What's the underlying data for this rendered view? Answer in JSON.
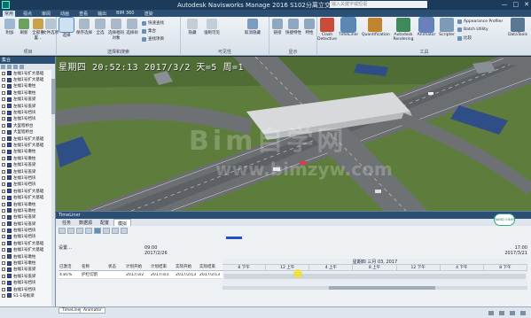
{
  "window": {
    "title": "Autodesk Navisworks Manage 2016    S102分离立交（老）.nwf",
    "search_placeholder": "输入关键字或短语",
    "min": "—",
    "max": "□",
    "close": "✕"
  },
  "menu": {
    "tabs": [
      "常用",
      "视点",
      "审阅",
      "动画",
      "查看",
      "输出",
      "BIM 360",
      "渲染"
    ],
    "active_index": 0
  },
  "ribbon": {
    "left_buttons": [
      "附加",
      "刷新",
      "全部重置…",
      "文件选项",
      "选择",
      "保存选择",
      "全选",
      "选择相同对象",
      "选择树"
    ],
    "group_labels": {
      "project": "项目",
      "select": "选择和搜索",
      "visibility": "可见性",
      "display": "显示",
      "tools": "工具"
    },
    "select_small": [
      "快速查找",
      "集合",
      "查找项目"
    ],
    "mid_buttons": [
      "隐藏",
      "强制可见",
      "取消隐藏",
      "链接",
      "快捷特性",
      "特性"
    ],
    "tool_buttons": [
      "Clash Detective",
      "TimeLiner",
      "Quantification",
      "Autodesk Rendering",
      "Animator",
      "Scripter",
      "DataTools"
    ],
    "tool_small": [
      "Appearance Profiler",
      "Batch Utility",
      "比较"
    ]
  },
  "left_panel": {
    "title": "集合",
    "items": [
      "左幅1号扩大基础",
      "左幅1号扩大基础",
      "左幅1号墩柱",
      "左幅1号墩柱",
      "左幅1号盖梁",
      "左幅1号盖梁",
      "左幅1号挡块",
      "左幅1号挡块",
      "大里程桥台",
      "大里程桥台",
      "左幅1号扩大基础",
      "左幅1号扩大基础",
      "左幅1号墩柱",
      "左幅1号墩柱",
      "左幅1号盖梁",
      "左幅1号盖梁",
      "左幅1号挡块",
      "左幅1号挡块",
      "右幅1号扩大基础",
      "右幅1号扩大基础",
      "右幅1号墩柱",
      "右幅1号墩柱",
      "右幅1号盖梁",
      "右幅1号盖梁",
      "右幅1号挡块",
      "右幅1号挡块",
      "右幅1号扩大基础",
      "右幅1号扩大基础",
      "右幅1号墩柱",
      "右幅1号墩柱",
      "右幅1号盖梁",
      "右幅1号盖梁",
      "右幅1号挡块",
      "右幅1号挡块",
      "S1-1号板梁"
    ]
  },
  "viewport": {
    "hud": "星期四 20:52:13 2017/3/2 天=5 周=1",
    "watermark1": "Bim自学网",
    "watermark2": "www.bimzyw.com"
  },
  "timeliner": {
    "title": "TimeLiner",
    "tabs": [
      "任务",
      "数据源",
      "配置",
      "模拟"
    ],
    "active_tab_index": 3,
    "settings_label": "设置…",
    "start_time": "09:00",
    "start_date": "2017/2/26",
    "end_time": "17:00",
    "end_date": "2017/3/21",
    "progress_fraction": 0.05,
    "gantt_header": "星期四 三月 03, 2017",
    "gantt_cols": [
      "8 下午",
      "12 上午",
      "4 上午",
      "8 上午",
      "12 下午",
      "4 下午",
      "8 下午"
    ],
    "columns": [
      "已激活",
      "名称",
      "状态",
      "计划开始",
      "计划结束",
      "实际开始",
      "实际结束"
    ],
    "rows": [
      [
        "4.81%",
        "护栏切割",
        "",
        "2017/3/2",
        "2017/3/3",
        "2017/2/13",
        "2017/2/13"
      ]
    ],
    "badge": "BUND 3 BIM"
  },
  "status": {
    "tabs": [
      "TimeLiner",
      "Animator"
    ]
  },
  "colors": {
    "titlebar": "#1c3b5a",
    "accent": "#2350c8",
    "cursor_highlight": "#f3e12a"
  }
}
